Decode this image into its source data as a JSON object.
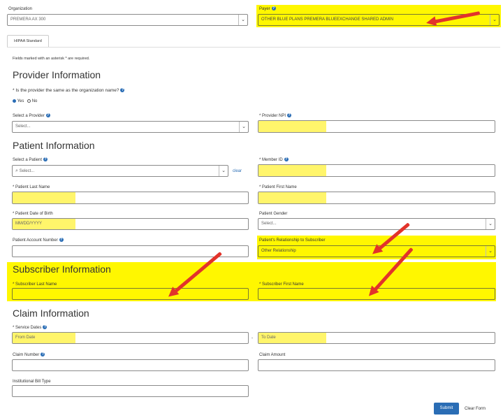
{
  "organization": {
    "label": "Organization",
    "value": "PREMERA AX 300"
  },
  "payer": {
    "label": "Payer",
    "value": "OTHER BLUE PLANS PREMERA BLUEEXCHANGE SHARED ADMIN"
  },
  "tab": {
    "label": "HIPAA Standard"
  },
  "required_note": "Fields marked with an asterisk * are required.",
  "provider": {
    "title": "Provider Information",
    "same_question": "* Is the provider the same as the organization name?",
    "yes_label": "Yes",
    "no_label": "No",
    "select_label": "Select a Provider",
    "select_placeholder": "Select...",
    "npi_label": "* Provider NPI"
  },
  "patient": {
    "title": "Patient Information",
    "select_label": "Select a Patient",
    "select_placeholder": "Select...",
    "clear_label": "clear",
    "member_id_label": "* Member ID",
    "last_name_label": "* Patient Last Name",
    "first_name_label": "* Patient First Name",
    "dob_label": "* Patient Date of Birth",
    "dob_placeholder": "MM/DD/YYYY",
    "gender_label": "Patient Gender",
    "gender_placeholder": "Select...",
    "account_label": "Patient Account Number",
    "relationship_label": "Patient's Relationship to Subscriber",
    "relationship_value": "Other Relationship"
  },
  "subscriber": {
    "title": "Subscriber Information",
    "last_name_label": "* Subscriber Last Name",
    "first_name_label": "* Subscriber First Name"
  },
  "claim": {
    "title": "Claim Information",
    "service_dates_label": "* Service Dates",
    "from_placeholder": "From Date",
    "to_placeholder": "To Date",
    "date_sep": "-",
    "number_label": "Claim Number",
    "amount_label": "Claim Amount",
    "bill_type_label": "Institutional Bill Type"
  },
  "actions": {
    "submit_label": "Submit",
    "clear_label": "Clear Form"
  },
  "icons": {
    "help": "question-circle-icon",
    "dropdown": "chevron-down-icon",
    "search": "search-icon"
  },
  "colors": {
    "highlight": "#fff700",
    "arrow": "#e2332b",
    "primary": "#2a6db5"
  }
}
